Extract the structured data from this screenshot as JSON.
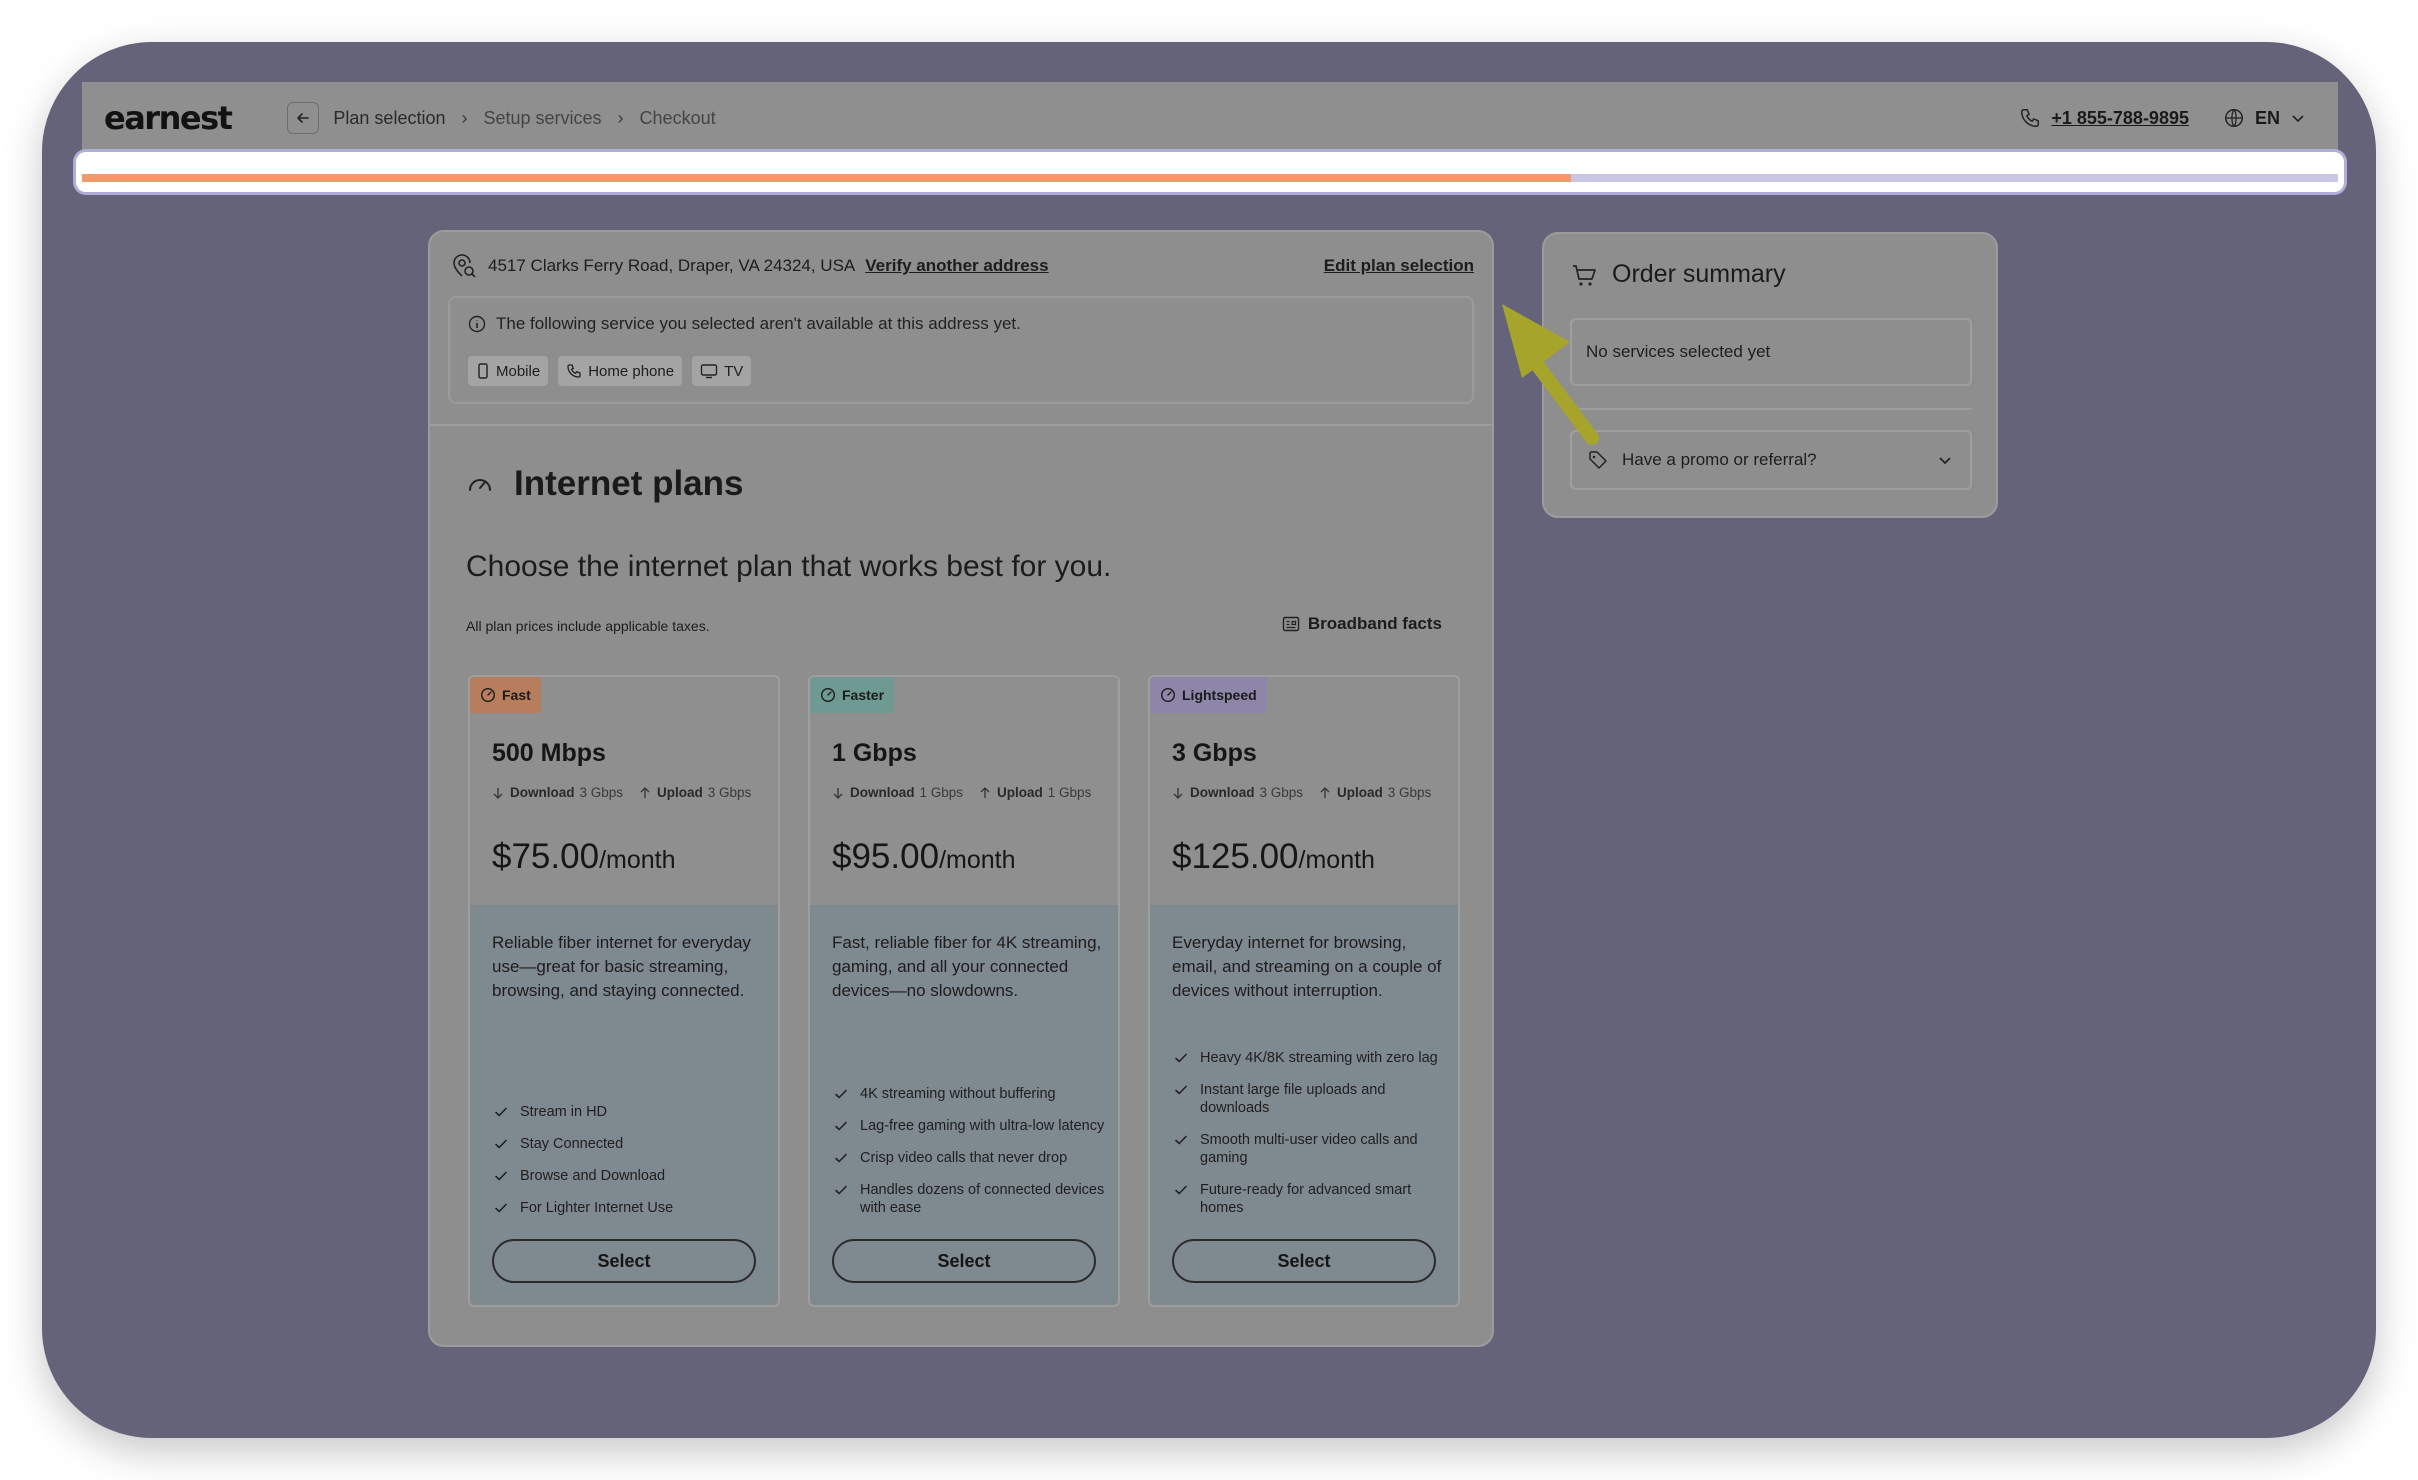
{
  "header": {
    "logo": "earnest",
    "breadcrumbs": [
      "Plan selection",
      "Setup services",
      "Checkout"
    ],
    "phone": "+1 855-788-9895",
    "language": "EN"
  },
  "progress": {
    "fraction": 0.66,
    "fill_color": "#ee9a6a"
  },
  "address": {
    "text": "4517 Clarks Ferry Road, Draper, VA 24324, USA",
    "verify_link": "Verify another address",
    "edit_link": "Edit plan selection"
  },
  "notice": {
    "text": "The following service you selected aren't available at this address yet.",
    "chips": [
      {
        "label": "Mobile",
        "icon": "mobile-icon"
      },
      {
        "label": "Home phone",
        "icon": "home-phone-icon"
      },
      {
        "label": "TV",
        "icon": "tv-icon"
      }
    ]
  },
  "main": {
    "title": "Internet plans",
    "subtitle": "Choose the internet plan that works best for you.",
    "taxes_note": "All plan prices include applicable taxes.",
    "broadband_facts": "Broadband facts"
  },
  "plans": [
    {
      "badge": "Fast",
      "badge_color": "#b87d5c",
      "speed": "500 Mbps",
      "download_label": "Download",
      "download_value": "3 Gbps",
      "upload_label": "Upload",
      "upload_value": "3 Gbps",
      "price": "$75.00",
      "price_unit": "/month",
      "description": "Reliable fiber internet for everyday use—great for basic streaming, browsing, and staying connected.",
      "features": [
        "Stream in HD",
        "Stay Connected",
        "Browse and Download",
        "For Lighter Internet Use"
      ],
      "button": "Select"
    },
    {
      "badge": "Faster",
      "badge_color": "#6f9a93",
      "speed": "1 Gbps",
      "download_label": "Download",
      "download_value": "1 Gbps",
      "upload_label": "Upload",
      "upload_value": "1 Gbps",
      "price": "$95.00",
      "price_unit": "/month",
      "description": "Fast, reliable fiber for 4K streaming, gaming, and all your connected devices—no slowdowns.",
      "features": [
        "4K streaming without buffering",
        "Lag-free gaming with ultra-low latency",
        "Crisp video calls that never drop",
        "Handles dozens of connected devices with ease"
      ],
      "button": "Select"
    },
    {
      "badge": "Lightspeed",
      "badge_color": "#8d86a8",
      "speed": "3 Gbps",
      "download_label": "Download",
      "download_value": "3 Gbps",
      "upload_label": "Upload",
      "upload_value": "3 Gbps",
      "price": "$125.00",
      "price_unit": "/month",
      "description": "Everyday internet for browsing, email, and streaming on a couple of devices without interruption.",
      "features": [
        "Heavy 4K/8K streaming with zero lag",
        "Instant large file uploads and downloads",
        "Smooth multi-user video calls and gaming",
        "Future-ready for advanced smart homes"
      ],
      "button": "Select"
    }
  ],
  "summary": {
    "title": "Order summary",
    "empty": "No services selected yet",
    "promo": "Have a promo or referral?"
  },
  "colors": {
    "overlay": "#64637a",
    "highlight_arrow": "#a7a42c",
    "progress_fill": "#ee9a6a"
  }
}
